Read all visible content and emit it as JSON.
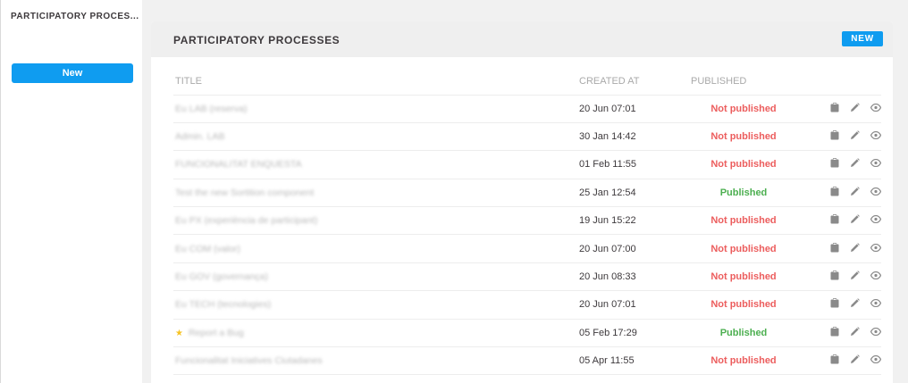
{
  "sidebar": {
    "heading": "PARTICIPATORY PROCES...",
    "new_label": "New"
  },
  "card": {
    "title": "PARTICIPATORY PROCESSES",
    "new_label": "NEW"
  },
  "table": {
    "headers": {
      "title": "TITLE",
      "created_at": "CREATED AT",
      "published": "PUBLISHED"
    },
    "rows": [
      {
        "title": "Eu LAB (reserva)",
        "created_at": "20 Jun 07:01",
        "status": "Not published",
        "published": false,
        "starred": false
      },
      {
        "title": "Admin. LAB",
        "created_at": "30 Jan 14:42",
        "status": "Not published",
        "published": false,
        "starred": false
      },
      {
        "title": "FUNCIONALITAT ENQUESTA",
        "created_at": "01 Feb 11:55",
        "status": "Not published",
        "published": false,
        "starred": false
      },
      {
        "title": "Test the new Sortition component",
        "created_at": "25 Jan 12:54",
        "status": "Published",
        "published": true,
        "starred": false
      },
      {
        "title": "Eu PX (experiència de participant)",
        "created_at": "19 Jun 15:22",
        "status": "Not published",
        "published": false,
        "starred": false
      },
      {
        "title": "Eu COM (valor)",
        "created_at": "20 Jun 07:00",
        "status": "Not published",
        "published": false,
        "starred": false
      },
      {
        "title": "Eu GOV (governança)",
        "created_at": "20 Jun 08:33",
        "status": "Not published",
        "published": false,
        "starred": false
      },
      {
        "title": "Eu TECH (tecnologies)",
        "created_at": "20 Jun 07:01",
        "status": "Not published",
        "published": false,
        "starred": false
      },
      {
        "title": "Report a Bug",
        "created_at": "05 Feb 17:29",
        "status": "Published",
        "published": true,
        "starred": true
      },
      {
        "title": "Funcionalitat Iniciatives Ciutadanes",
        "created_at": "05 Apr 11:55",
        "status": "Not published",
        "published": false,
        "starred": false
      }
    ]
  },
  "icons": {
    "copy": "copy-icon",
    "edit": "pencil-icon",
    "preview": "eye-icon"
  },
  "colors": {
    "accent": "#0f9cf0",
    "not_published": "#ec5d5d",
    "published": "#4caf50",
    "star": "#f6c324"
  }
}
